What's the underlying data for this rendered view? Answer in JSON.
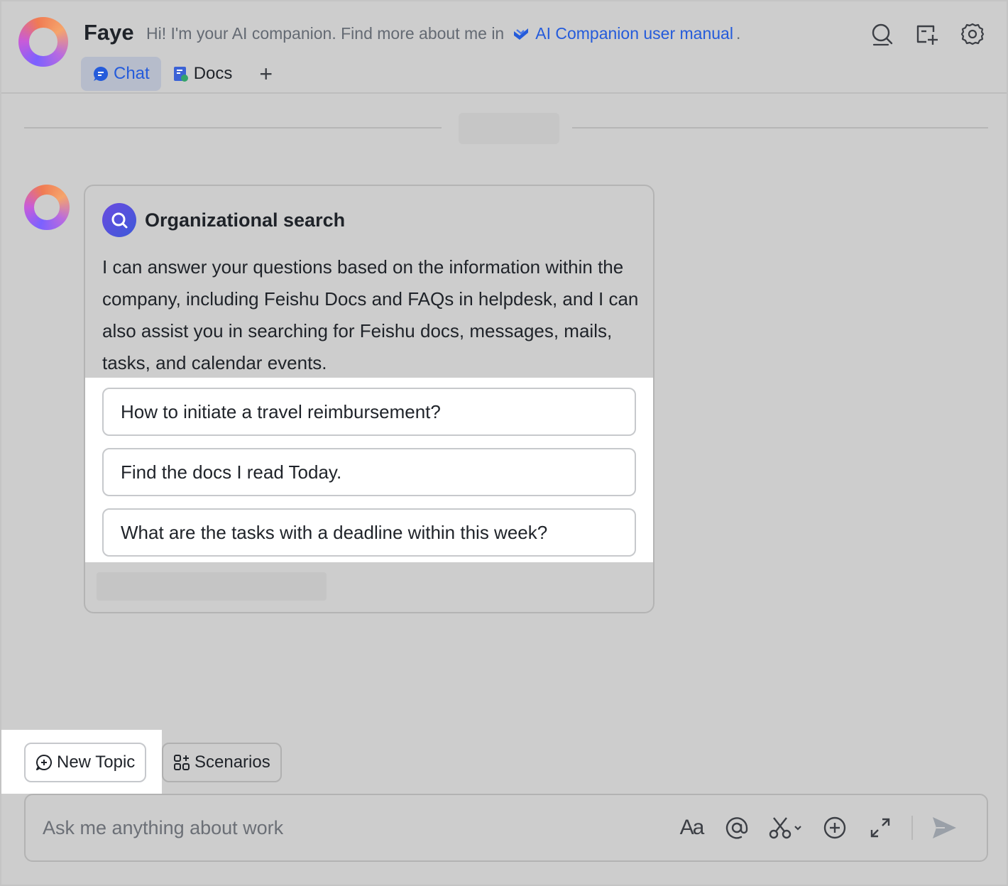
{
  "header": {
    "bot_name": "Faye",
    "intro_text": "Hi! I'm your AI companion. Find more about me in",
    "manual_link": "AI Companion user manual",
    "intro_end": ".",
    "actions": [
      {
        "icon": "search-icon"
      },
      {
        "icon": "new-window-icon"
      },
      {
        "icon": "settings-gear-icon"
      }
    ]
  },
  "tabs": [
    {
      "label": "Chat",
      "icon": "chat-bubble-icon",
      "active": true
    },
    {
      "label": "Docs",
      "icon": "docs-icon",
      "active": false
    }
  ],
  "tab_add_label": "+",
  "message": {
    "card_title": "Organizational search",
    "card_description": "I can answer your questions based on the information within the company, including Feishu Docs and FAQs in helpdesk, and I can also assist you in searching for Feishu docs, messages, mails, tasks, and calendar events.",
    "suggestions": [
      "How to initiate a travel reimbursement?",
      "Find the docs I read Today.",
      "What are the tasks with a deadline within this week?"
    ]
  },
  "quick_actions": {
    "new_topic": "New Topic",
    "scenarios": "Scenarios"
  },
  "input": {
    "placeholder": "Ask me anything about work",
    "value": "",
    "font_tool_label": "Aa"
  },
  "colors": {
    "accent": "#245bdb",
    "background": "#cdcdcd",
    "highlight": "#ffffff"
  }
}
